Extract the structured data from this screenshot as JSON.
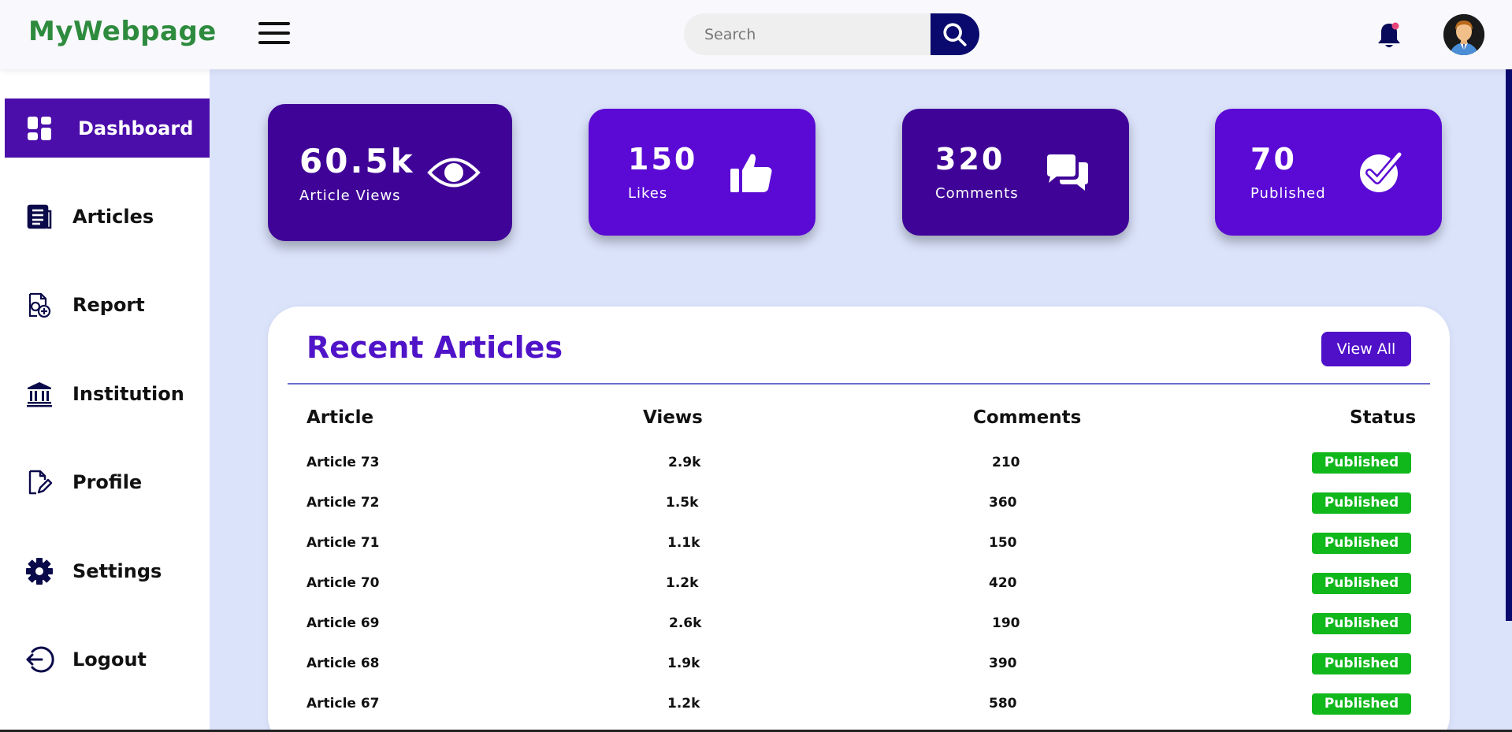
{
  "header": {
    "logo": "MyWebpage",
    "search_placeholder": "Search"
  },
  "sidebar": {
    "items": [
      {
        "label": "Dashboard",
        "icon": "dashboard-icon",
        "active": true
      },
      {
        "label": "Articles",
        "icon": "articles-icon"
      },
      {
        "label": "Report",
        "icon": "report-icon"
      },
      {
        "label": "Institution",
        "icon": "institution-icon"
      },
      {
        "label": "Profile",
        "icon": "profile-icon"
      },
      {
        "label": "Settings",
        "icon": "gear-icon"
      },
      {
        "label": "Logout",
        "icon": "logout-icon"
      }
    ]
  },
  "stats": [
    {
      "value": "60.5k",
      "label": "Article Views",
      "icon": "eye-icon",
      "color": "#3f0497"
    },
    {
      "value": "150",
      "label": "Likes",
      "icon": "thumbs-up-icon",
      "color": "#5a0ad4"
    },
    {
      "value": "320",
      "label": "Comments",
      "icon": "comments-icon",
      "color": "#3f0497"
    },
    {
      "value": "70",
      "label": "Published",
      "icon": "check-circle-icon",
      "color": "#5a0ad4"
    }
  ],
  "recent": {
    "title": "Recent Articles",
    "view_all": "View All",
    "columns": [
      "Article",
      "Views",
      "Comments",
      "Status"
    ],
    "rows": [
      {
        "article": "Article 73",
        "views": "2.9k",
        "comments": "210",
        "status": "Published"
      },
      {
        "article": "Article 72",
        "views": "1.5k",
        "comments": "360",
        "status": "Published"
      },
      {
        "article": "Article 71",
        "views": "1.1k",
        "comments": "150",
        "status": "Published"
      },
      {
        "article": "Article 70",
        "views": "1.2k",
        "comments": "420",
        "status": "Published"
      },
      {
        "article": "Article 69",
        "views": "2.6k",
        "comments": "190",
        "status": "Published"
      },
      {
        "article": "Article 68",
        "views": "1.9k",
        "comments": "390",
        "status": "Published"
      },
      {
        "article": "Article 67",
        "views": "1.2k",
        "comments": "580",
        "status": "Published"
      }
    ]
  },
  "colors": {
    "accent": "#5014c8",
    "sidebar_active": "#4b0eaa",
    "logo": "#2e8b3e",
    "badge": "#11b81c",
    "background": "#dbe3fb"
  }
}
